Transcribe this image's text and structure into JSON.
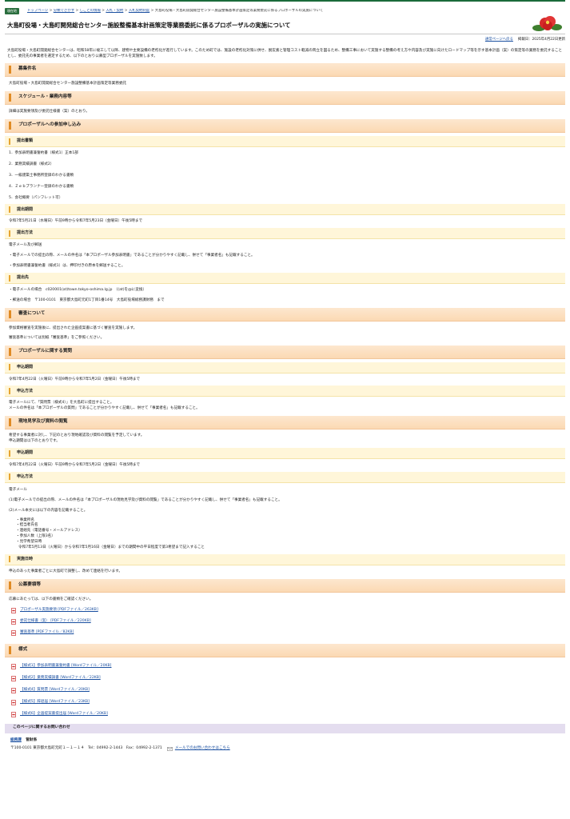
{
  "badge": "現在地",
  "breadcrumb": {
    "home": "トップページ",
    "cat1": "分類でさがす",
    "cat2": "しごとの情報",
    "cat3": "入札・契約",
    "cat4": "入札契約制度",
    "current": "大島町役場・大島町開発総合センター施設整備基本計画策定等業務委託に係るプロポーザルの実施について"
  },
  "page_title": "大島町役場・大島町開発総合センター施設整備基本計画策定等業務委託に係るプロポーザルの実施について",
  "meta": {
    "normal_page_link": "通常ページへ戻る",
    "published": "掲載日：2025年4月22日更新"
  },
  "intro": "大島町役場・大島町開発総合センターは、昭和58年に竣工して以降、建物や主要設備の老朽化が進行しています。このため町では、施設の老朽化対策に併せ、脱炭素と管理コスト軽減の両立を図るため、整備工事において実施する整備の考え方や内容及び実施に向けたロードマップ等を示す基本計画（案）の策定等の業務を委託することとし、委託先の事業者を選定するため、以下のとおり公募型プロポーザルを実施致します。",
  "s1": {
    "h": "募集件名",
    "p": "大島町役場・大島町開発総合センター施設整備基本計画策定等業務委託"
  },
  "s2": {
    "h": "スケジュール・業務内容等",
    "p": "詳細は実施要領及び委託仕様書（案）のとおり。"
  },
  "s3": {
    "h": "プロポーザルへの参加申し込み",
    "docs_h": "提出書類",
    "docs": [
      "1．参加表明書兼誓約書（様式1）正本1部",
      "2．業務実績調書（様式2）",
      "3．一級建築士事務所登録のわかる書類",
      "4．Ｚｅｂプランナー登録のわかる書類",
      "5．会社概要（パンフレット可）"
    ],
    "period_h": "提出期間",
    "period": "令和7年5月21日（水曜日）午前9時から令和7年5月23日（金曜日）午後5時まで",
    "method_h": "提出方法",
    "method": [
      "電子メール及び郵送",
      "・電子メールでの提出の際、メールの件名は「本プロポーザル参加表明書」であることが分かりやすく記載し、併せて「事業者名」も記載すること。",
      "・参加表明書兼誓約書（様式1）は、押印付きの原本を郵送すること。"
    ],
    "dest_h": "提出先",
    "dest": [
      "・電子メールの場合　c020001(at)town.tokyo-oshima.lg.jp　（(at)を@に変換）",
      "・郵送の場合　〒100-0101　東京都大島町元町1丁目1番14号　大島町役場総務課財務　まで"
    ]
  },
  "s4": {
    "h": "審査について",
    "p": [
      "参加資格審査を実施後に、提出された企画提案書に基づく審査を実施します。",
      "審査基準については別紙「審査基準」をご参照ください。"
    ]
  },
  "s5": {
    "h": "プロポーザルに関する質問",
    "period_h": "申込期間",
    "period": "令和7年4月22日（火曜日）午前9時から令和7年5月2日（金曜日）午後5時まで",
    "method_h": "申込方法",
    "method": [
      "電子メールにて、「質問票（様式4）」を大島町に提出すること。",
      "メールの件名は「本プロポーザルの質問」であることが分かりやすく記載し、併せて「事業者名」も記載すること。"
    ]
  },
  "s6": {
    "h": "現地見学及び資料の閲覧",
    "p": [
      "希望する事業者に対し、下記のとおり現地確認及び資料の閲覧を予定しています。",
      "申込期間は以下のとおりです。"
    ],
    "period_h": "申込期間",
    "period": "令和7年4月22日（火曜日）午前9時から令和7年5月2日（金曜日）午後5時まで",
    "method_h": "申込方法",
    "method_a": "電子メール",
    "method_b": "(1)電子メールでの提出の際、メールの件名は「本プロポーザルの現地見学及び資料の閲覧」であることが分かりやすく記載し、併せて「事業者名」も記載すること。",
    "method_c": "(2)メール本文には以下の内容を記載すること。",
    "items": [
      "・事業所名",
      "・担当者氏名",
      "・連絡先（電話番号・メールアドレス）",
      "・参加人数（上限3名）",
      "・見学希望日時"
    ],
    "items_note": "令和7年5月13日（火曜日）から令和7年5月16日（金曜日）までの期間中の平日程度で第3希望まで記入すること",
    "date_h": "実施日時",
    "date": "申込のあった事業者ごとに大島町で調整し、改めて連絡を行います。"
  },
  "s7": {
    "h": "公募要領等",
    "p": "応募にあたっては、以下の書類をご確認ください。",
    "links": [
      "プロポーザル実施要領 [PDFファイル／263KB]",
      "委託仕様書（案） [PDFファイル／220KB]",
      "審査基準 [PDFファイル／82KB]"
    ],
    "forms_h": "様式",
    "forms": [
      "【様式1】参加表明書兼誓約書 [Wordファイル／20KB]",
      "【様式2】業務実績調書 [Wordファイル／22KB]",
      "【様式4】質問票 [Wordファイル／20KB]",
      "【様式5】辞退届 [Wordファイル／23KB]",
      "【様式6】企画提案書提出届 [Wordファイル／20KB]"
    ]
  },
  "contact": {
    "h": "このページに関するお問い合わせ",
    "dept": "総務課",
    "section": "管財係",
    "address": "〒100-0101 東京都大島町元町１－１－１４　Tel：04992-2-1443　Fax：04992-2-1371",
    "mail_link": "メールでのお問い合わせはこちら"
  }
}
